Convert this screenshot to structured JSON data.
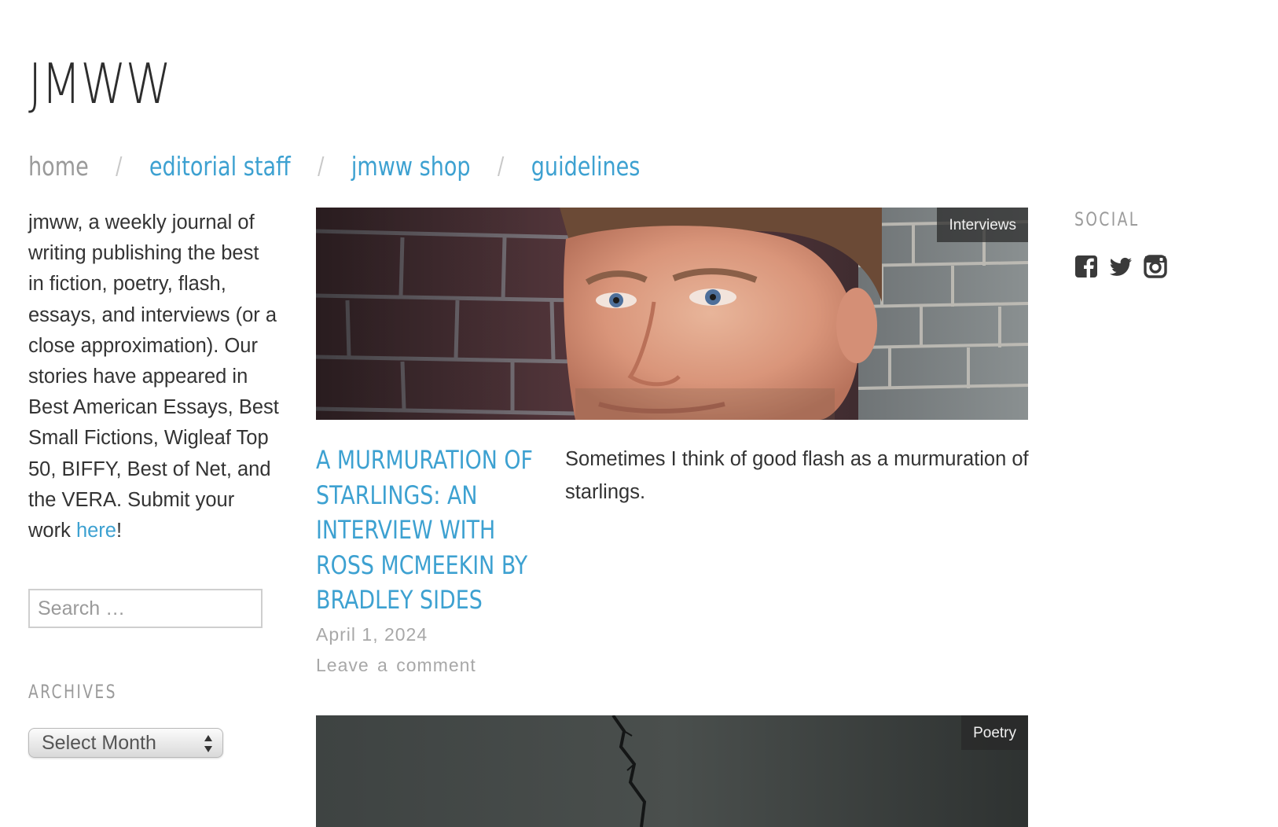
{
  "site": {
    "title": "JMWW"
  },
  "nav": {
    "items": [
      {
        "label": "home",
        "current": true
      },
      {
        "label": "editorial staff",
        "current": false
      },
      {
        "label": "jmww shop",
        "current": false
      },
      {
        "label": "guidelines",
        "current": false
      }
    ],
    "separator": "/"
  },
  "sidebar": {
    "intro_text": "jmww, a weekly journal of writing publishing the best in fiction, poetry, flash, essays, and interviews (or a close approximation). Our stories have appeared in Best American Essays, Best Small Fictions, Wigleaf Top 50, BIFFY, Best of Net, and the VERA. Submit your work ",
    "intro_link": "here",
    "intro_end": "!",
    "search": {
      "placeholder": "Search …"
    },
    "archives": {
      "title": "ARCHIVES",
      "selected": "Select Month"
    }
  },
  "social": {
    "title": "SOCIAL",
    "icons": [
      "facebook-icon",
      "twitter-icon",
      "instagram-icon"
    ]
  },
  "posts": [
    {
      "category": "Interviews",
      "title_lines": [
        "A MURMURATION OF",
        "STARLINGS: AN",
        "INTERVIEW WITH",
        "ROSS MCMEEKIN BY",
        "BRADLEY SIDES"
      ],
      "date": "April 1, 2024",
      "comment": "Leave a comment",
      "excerpt": "Sometimes I think of good flash as a murmuration of starlings."
    },
    {
      "category": "Poetry"
    }
  ],
  "colors": {
    "link": "#3da1d1",
    "text": "#333333",
    "muted": "#9b9b9b",
    "badge_bg": "#2f2f2f"
  }
}
